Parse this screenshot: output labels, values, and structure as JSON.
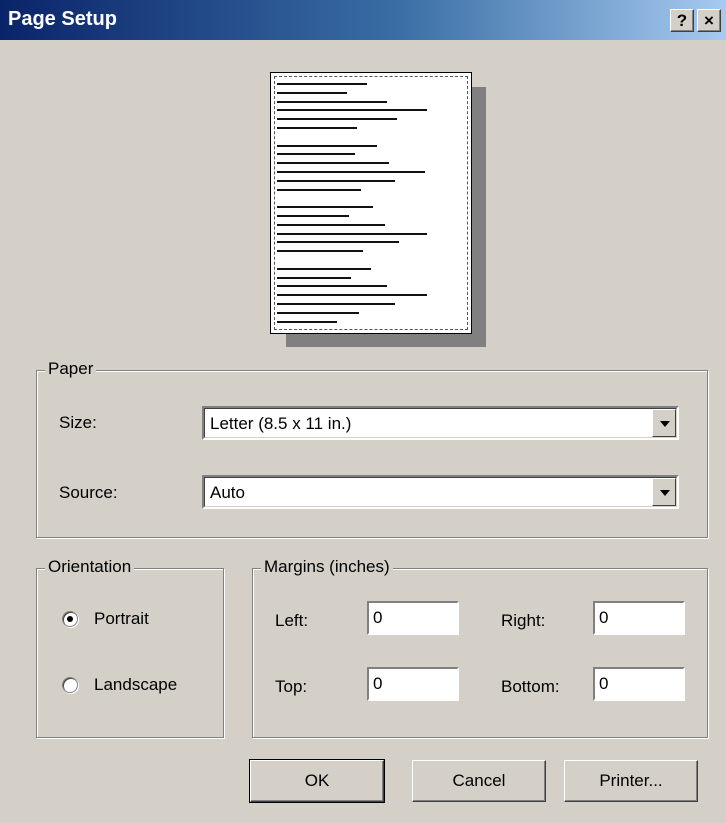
{
  "window": {
    "title": "Page Setup",
    "help_glyph": "?",
    "close_glyph": "×"
  },
  "paper": {
    "group_label": "Paper",
    "size_label": "Size:",
    "size_value": "Letter (8.5 x 11 in.)",
    "source_label": "Source:",
    "source_value": "Auto"
  },
  "orientation": {
    "group_label": "Orientation",
    "portrait_label": "Portrait",
    "landscape_label": "Landscape",
    "selected": "Portrait"
  },
  "margins": {
    "group_label": "Margins (inches)",
    "left_label": "Left:",
    "left_value": "0",
    "right_label": "Right:",
    "right_value": "0",
    "top_label": "Top:",
    "top_value": "0",
    "bottom_label": "Bottom:",
    "bottom_value": "0"
  },
  "buttons": {
    "ok": "OK",
    "cancel": "Cancel",
    "printer": "Printer..."
  },
  "colors": {
    "dialog_bg": "#d4d0c8",
    "title_start": "#0a246a",
    "title_end": "#a6caf0"
  }
}
